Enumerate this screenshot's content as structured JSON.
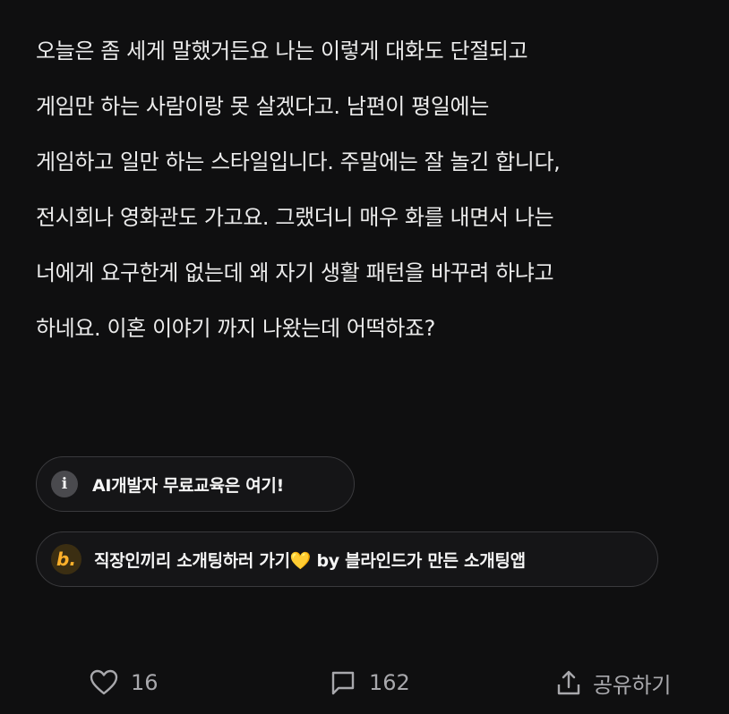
{
  "post": {
    "lines": [
      "오늘은 좀 세게 말했거든요 나는 이렇게 대화도 단절되고",
      "게임만 하는 사람이랑 못 살겠다고. 남편이 평일에는",
      "게임하고 일만 하는 스타일입니다. 주말에는 잘 놀긴 합니다,",
      "전시회나 영화관도 가고요. 그랬더니 매우 화를 내면서 나는",
      "너에게 요구한게 없는데 왜 자기 생활 패턴을 바꾸려 하냐고",
      "하네요. 이혼 이야기 까지 나왔는데 어떡하죠?"
    ]
  },
  "chips": {
    "info": {
      "icon": "i",
      "icon_name": "info-icon",
      "label": "AI개발자 무료교육은 여기!"
    },
    "ad": {
      "icon": "b.",
      "icon_name": "blind-logo-icon",
      "label": "직장인끼리 소개팅하러 가기💛 by 블라인드가 만든 소개팅앱"
    }
  },
  "footer": {
    "like_count": "16",
    "comment_count": "162",
    "share_label": "공유하기"
  },
  "colors": {
    "background": "#0f0f10",
    "text": "#ececec",
    "muted": "#a8a8ac",
    "chip_border": "#3a3a3d",
    "brand_orange": "#ffb12b"
  }
}
